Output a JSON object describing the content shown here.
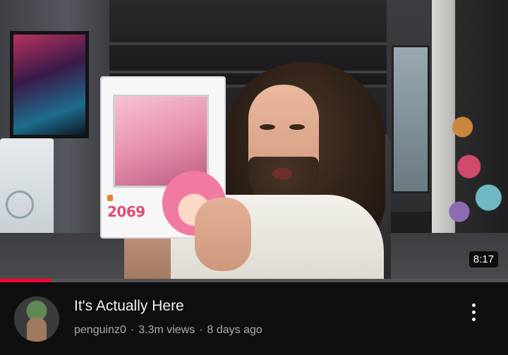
{
  "video": {
    "title": "It's Actually Here",
    "channel": "penguinz0",
    "views": "3.3m views",
    "age": "8 days ago",
    "separator": "·",
    "duration": "8:17",
    "watch_progress": 0.1,
    "progress_color": "#ff0033"
  },
  "thumbnail": {
    "product_box": {
      "number": "2069"
    }
  },
  "icons": {
    "menu": "more-vert-icon"
  }
}
